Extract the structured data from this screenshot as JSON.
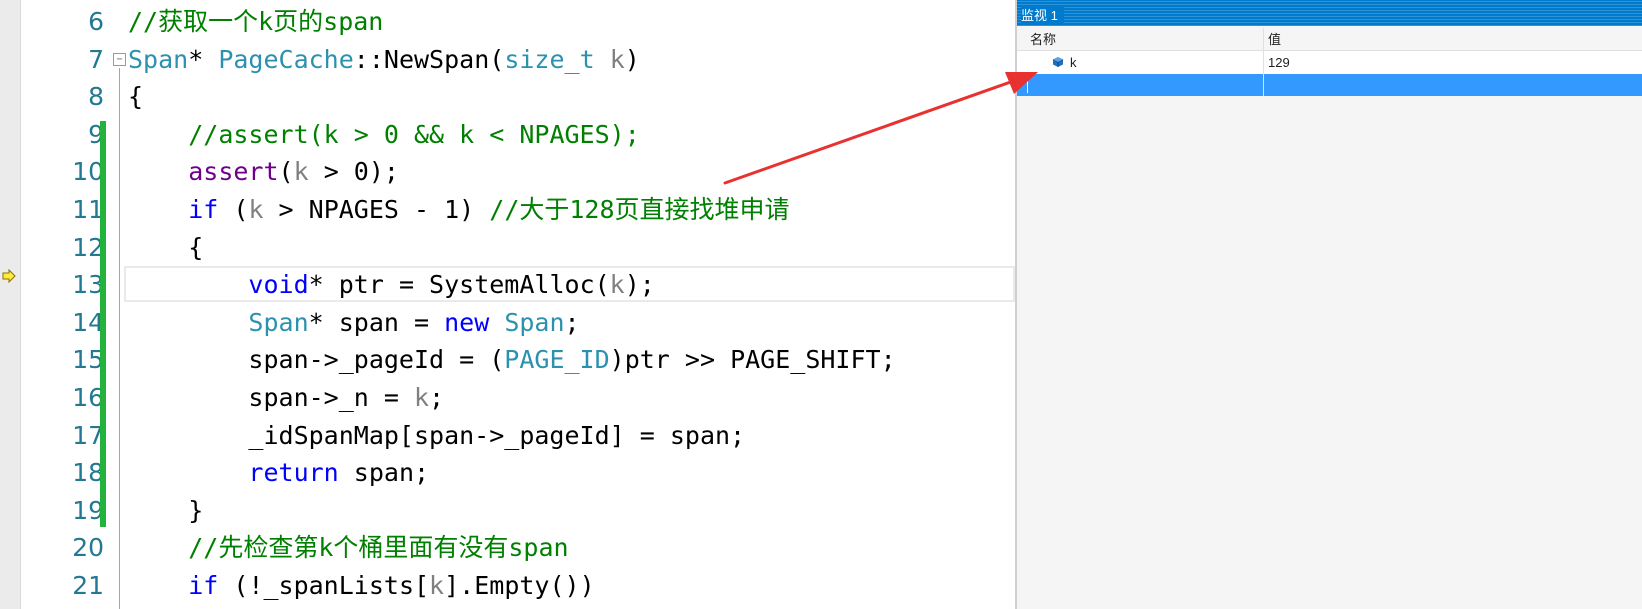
{
  "editor": {
    "line_numbers": [
      "6",
      "7",
      "8",
      "9",
      "10",
      "11",
      "12",
      "13",
      "14",
      "15",
      "16",
      "17",
      "18",
      "19",
      "20",
      "21"
    ],
    "lines": [
      [
        {
          "t": "//获取一个k页的span",
          "c": "cm"
        }
      ],
      [
        {
          "t": "Span",
          "c": "ty"
        },
        {
          "t": "* "
        },
        {
          "t": "PageCache",
          "c": "ty"
        },
        {
          "t": "::NewSpan("
        },
        {
          "t": "size_t",
          "c": "ty"
        },
        {
          "t": " "
        },
        {
          "t": "k",
          "c": "pm"
        },
        {
          "t": ")"
        }
      ],
      [
        {
          "t": "{"
        }
      ],
      [
        {
          "t": "    "
        },
        {
          "t": "//assert(k > 0 && k < NPAGES);",
          "c": "cm"
        }
      ],
      [
        {
          "t": "    "
        },
        {
          "t": "assert",
          "c": "mc"
        },
        {
          "t": "("
        },
        {
          "t": "k",
          "c": "pm"
        },
        {
          "t": " > 0);"
        }
      ],
      [
        {
          "t": "    "
        },
        {
          "t": "if",
          "c": "kw"
        },
        {
          "t": " ("
        },
        {
          "t": "k",
          "c": "pm"
        },
        {
          "t": " > NPAGES - 1) "
        },
        {
          "t": "//大于128页直接找堆申请",
          "c": "cm"
        }
      ],
      [
        {
          "t": "    {"
        }
      ],
      [
        {
          "t": "        "
        },
        {
          "t": "void",
          "c": "kw"
        },
        {
          "t": "* ptr = SystemAlloc("
        },
        {
          "t": "k",
          "c": "pm"
        },
        {
          "t": ");"
        }
      ],
      [
        {
          "t": "        "
        },
        {
          "t": "Span",
          "c": "ty"
        },
        {
          "t": "* span = "
        },
        {
          "t": "new",
          "c": "kw"
        },
        {
          "t": " "
        },
        {
          "t": "Span",
          "c": "ty"
        },
        {
          "t": ";"
        }
      ],
      [
        {
          "t": "        span->_pageId = ("
        },
        {
          "t": "PAGE_ID",
          "c": "ty"
        },
        {
          "t": ")ptr >> PAGE_SHIFT;"
        }
      ],
      [
        {
          "t": "        span->_n = "
        },
        {
          "t": "k",
          "c": "pm"
        },
        {
          "t": ";"
        }
      ],
      [
        {
          "t": "        _idSpanMap[span->_pageId] = span;"
        }
      ],
      [
        {
          "t": "        "
        },
        {
          "t": "return",
          "c": "kw"
        },
        {
          "t": " span;"
        }
      ],
      [
        {
          "t": "    }"
        }
      ],
      [
        {
          "t": "    "
        },
        {
          "t": "//先检查第k个桶里面有没有span",
          "c": "cm"
        }
      ],
      [
        {
          "t": "    "
        },
        {
          "t": "if",
          "c": "kw"
        },
        {
          "t": " (!_spanLists["
        },
        {
          "t": "k",
          "c": "pm"
        },
        {
          "t": "].Empty())"
        }
      ]
    ],
    "current_line_index": 7,
    "colors": {
      "keyword": "#0000ff",
      "type": "#2b91af",
      "comment": "#008000",
      "param": "#808080",
      "macro": "#6f008a",
      "line_number": "#237893",
      "change_bar": "#23b23b"
    }
  },
  "watch": {
    "title": "监视 1",
    "columns": {
      "name": "名称",
      "value": "值"
    },
    "rows": [
      {
        "name": "k",
        "value": "129"
      }
    ],
    "colors": {
      "title_bar": "#007acc",
      "selection": "#3399ff"
    }
  },
  "annotation": {
    "arrow_color": "#e8322f"
  }
}
